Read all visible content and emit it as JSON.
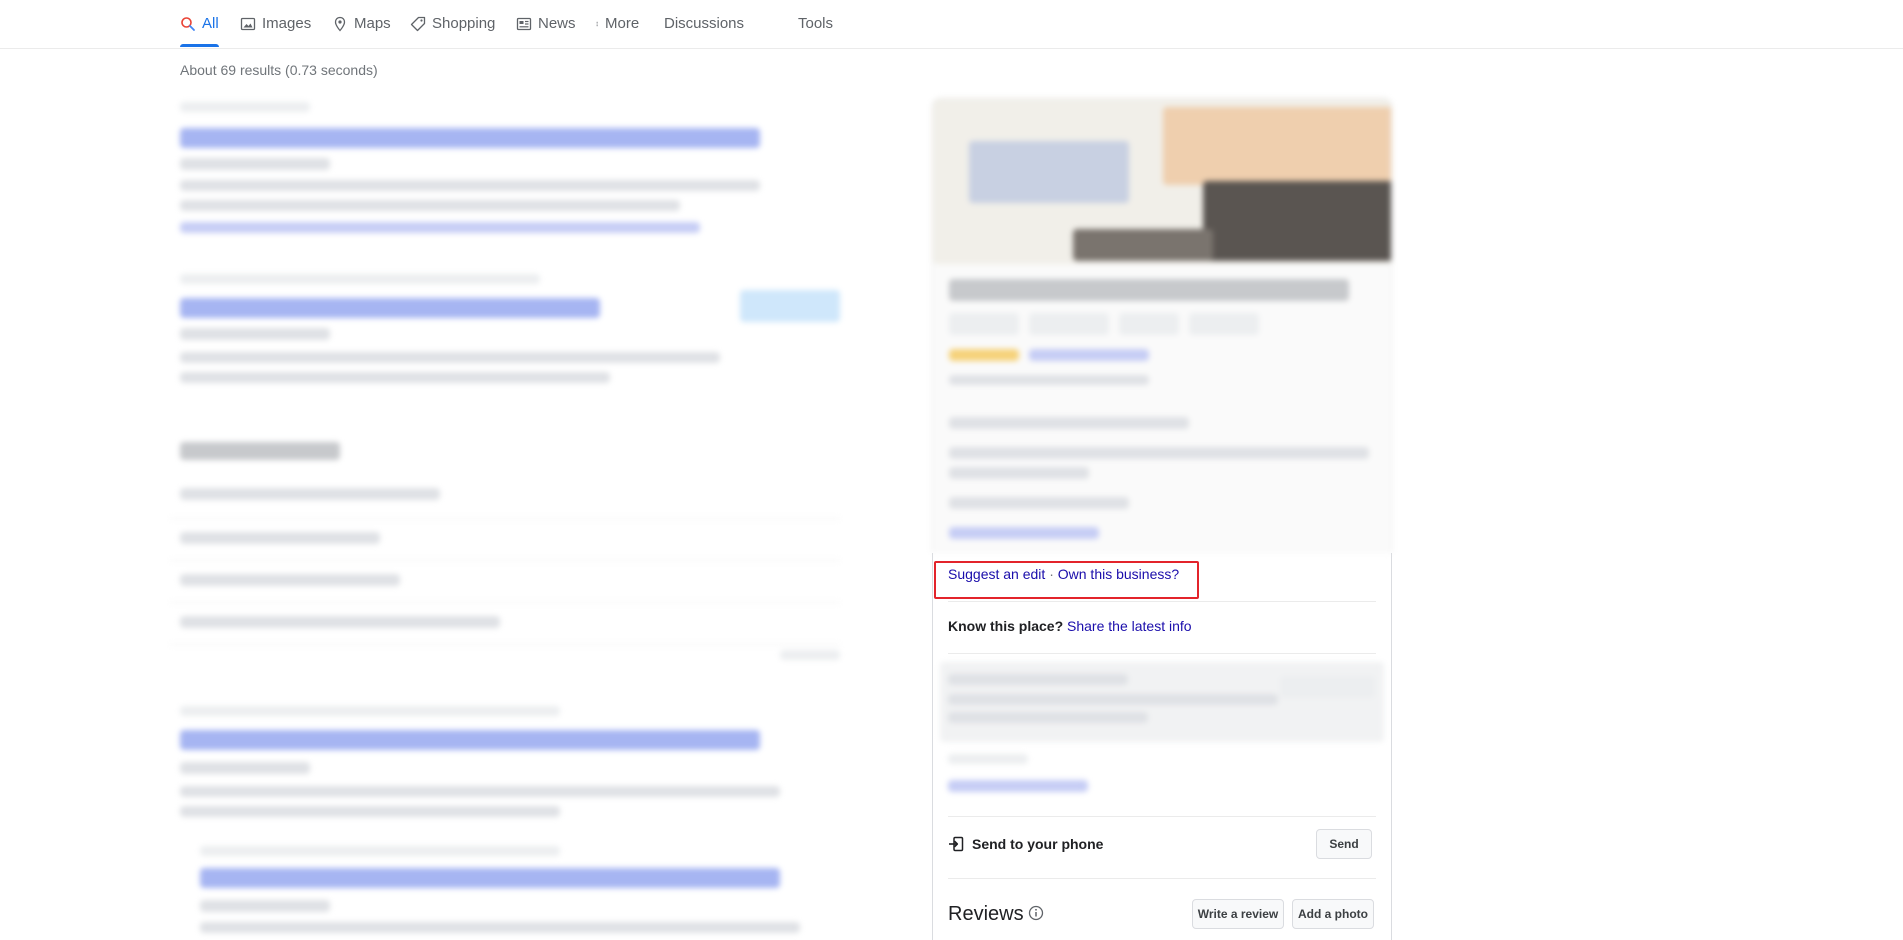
{
  "tabs": [
    {
      "label": "All",
      "icon": "search-icon",
      "active": true
    },
    {
      "label": "Images",
      "icon": "image-icon",
      "active": false
    },
    {
      "label": "Maps",
      "icon": "map-pin-icon",
      "active": false
    },
    {
      "label": "Shopping",
      "icon": "tag-icon",
      "active": false
    },
    {
      "label": "News",
      "icon": "newspaper-icon",
      "active": false
    },
    {
      "label": "More",
      "icon": "more-vertical-icon",
      "active": false
    },
    {
      "label": "Discussions",
      "icon": "",
      "active": false
    },
    {
      "label": "Tools",
      "icon": "",
      "active": false
    }
  ],
  "result_stats": "About 69 results (0.73 seconds)",
  "knowledge_panel": {
    "suggest_edit": "Suggest an edit",
    "separator": "·",
    "own_business": "Own this business?",
    "know_place_label": "Know this place?",
    "share_info_link": "Share the latest info",
    "send_to_phone_label": "Send to your phone",
    "send_button": "Send",
    "reviews_title": "Reviews",
    "write_review_button": "Write a review",
    "add_photo_button": "Add a photo"
  },
  "colors": {
    "accent": "#1a73e8",
    "link": "#1a0dab",
    "highlight_box": "#e3242b"
  }
}
